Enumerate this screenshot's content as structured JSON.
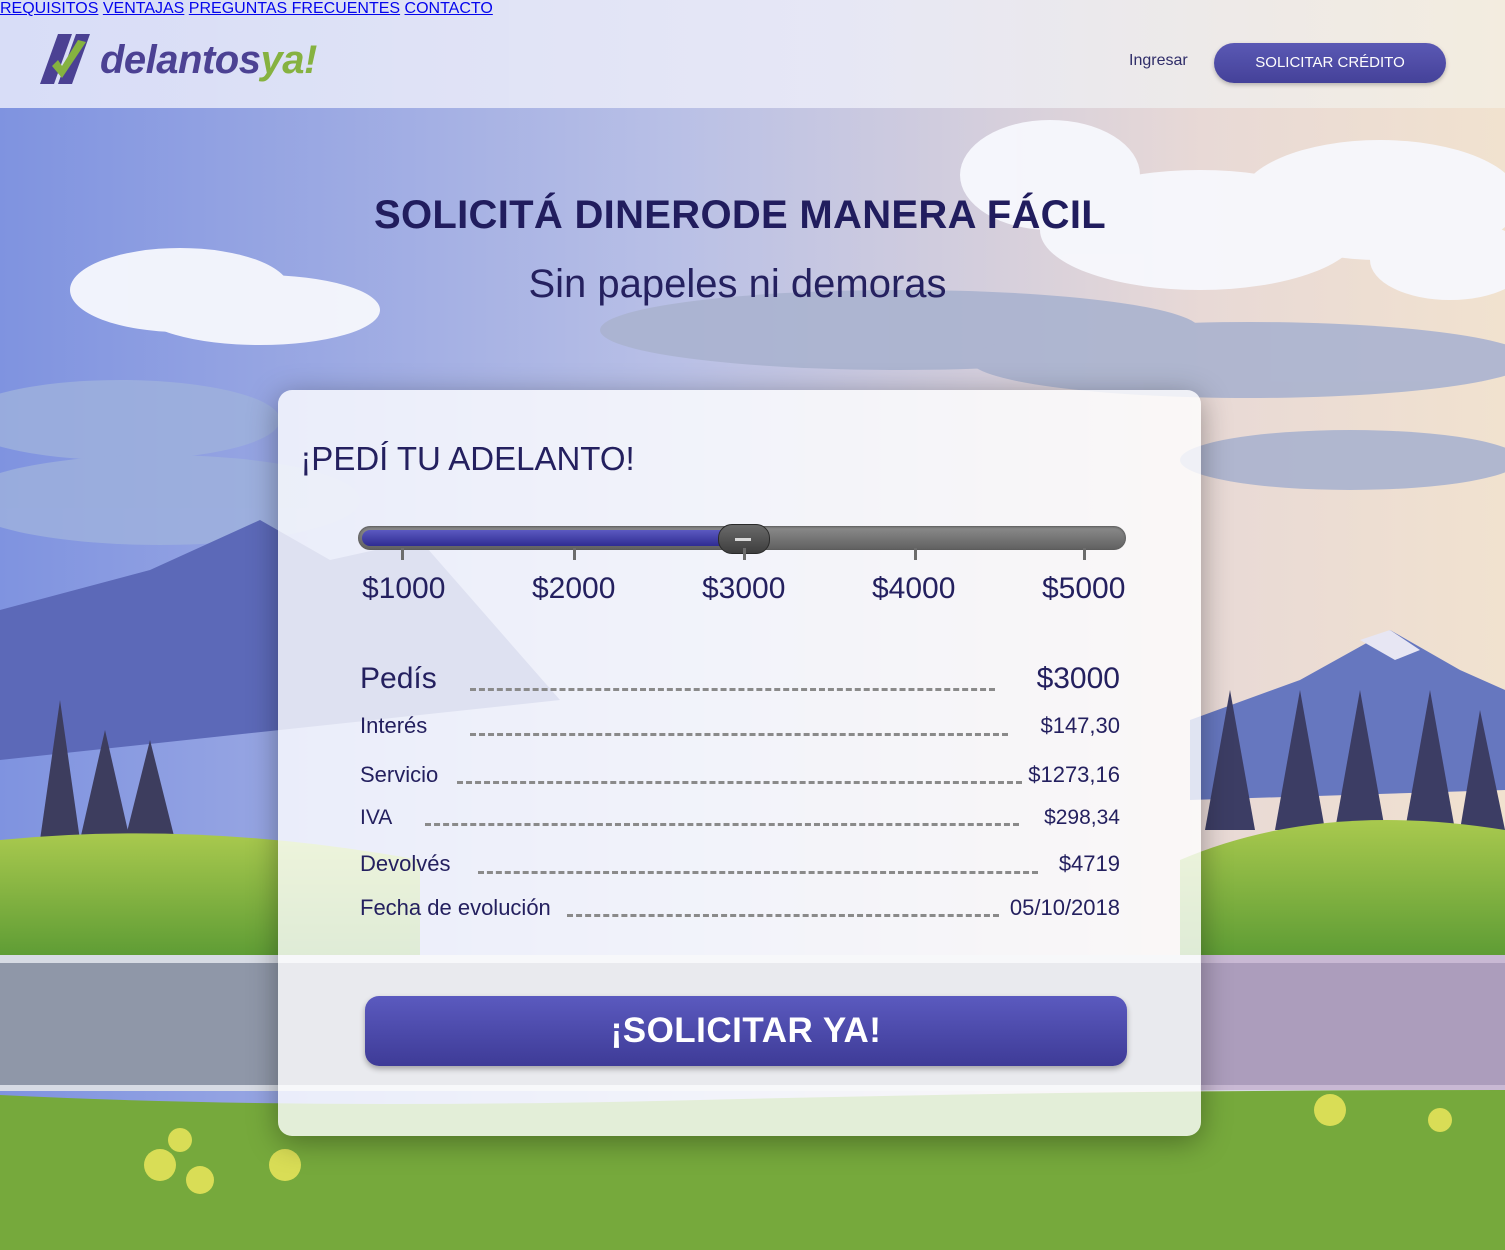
{
  "brand": {
    "name_part1": "delantos",
    "name_part2": "ya!",
    "colors": {
      "purple": "#4a3f91",
      "green": "#86b33b"
    }
  },
  "nav": {
    "items": [
      "REQUISITOS",
      "VENTAJAS",
      "PREGUNTAS FRECUENTES",
      "CONTACTO"
    ],
    "login": "Ingresar",
    "cta": "SOLICITAR CRÉDITO"
  },
  "hero": {
    "title": "SOLICITÁ DINERODE MANERA FÁCIL",
    "subtitle": "Sin papeles ni demoras"
  },
  "calculator": {
    "title": "¡PEDÍ TU ADELANTO!",
    "slider": {
      "min": 1000,
      "max": 5000,
      "value": 3000,
      "tick_labels": [
        "$1000",
        "$2000",
        "$3000",
        "$4000",
        "$5000"
      ]
    },
    "rows": [
      {
        "label": "Pedís",
        "value": "$3000"
      },
      {
        "label": "Interés",
        "value": "$147,30"
      },
      {
        "label": "Servicio",
        "value": "$1273,16"
      },
      {
        "label": "IVA",
        "value": "$298,34"
      },
      {
        "label": "Devolvés",
        "value": "$4719"
      },
      {
        "label": "Fecha de evolución",
        "value": "05/10/2018"
      }
    ],
    "cta": "¡SOLICITAR YA!"
  }
}
